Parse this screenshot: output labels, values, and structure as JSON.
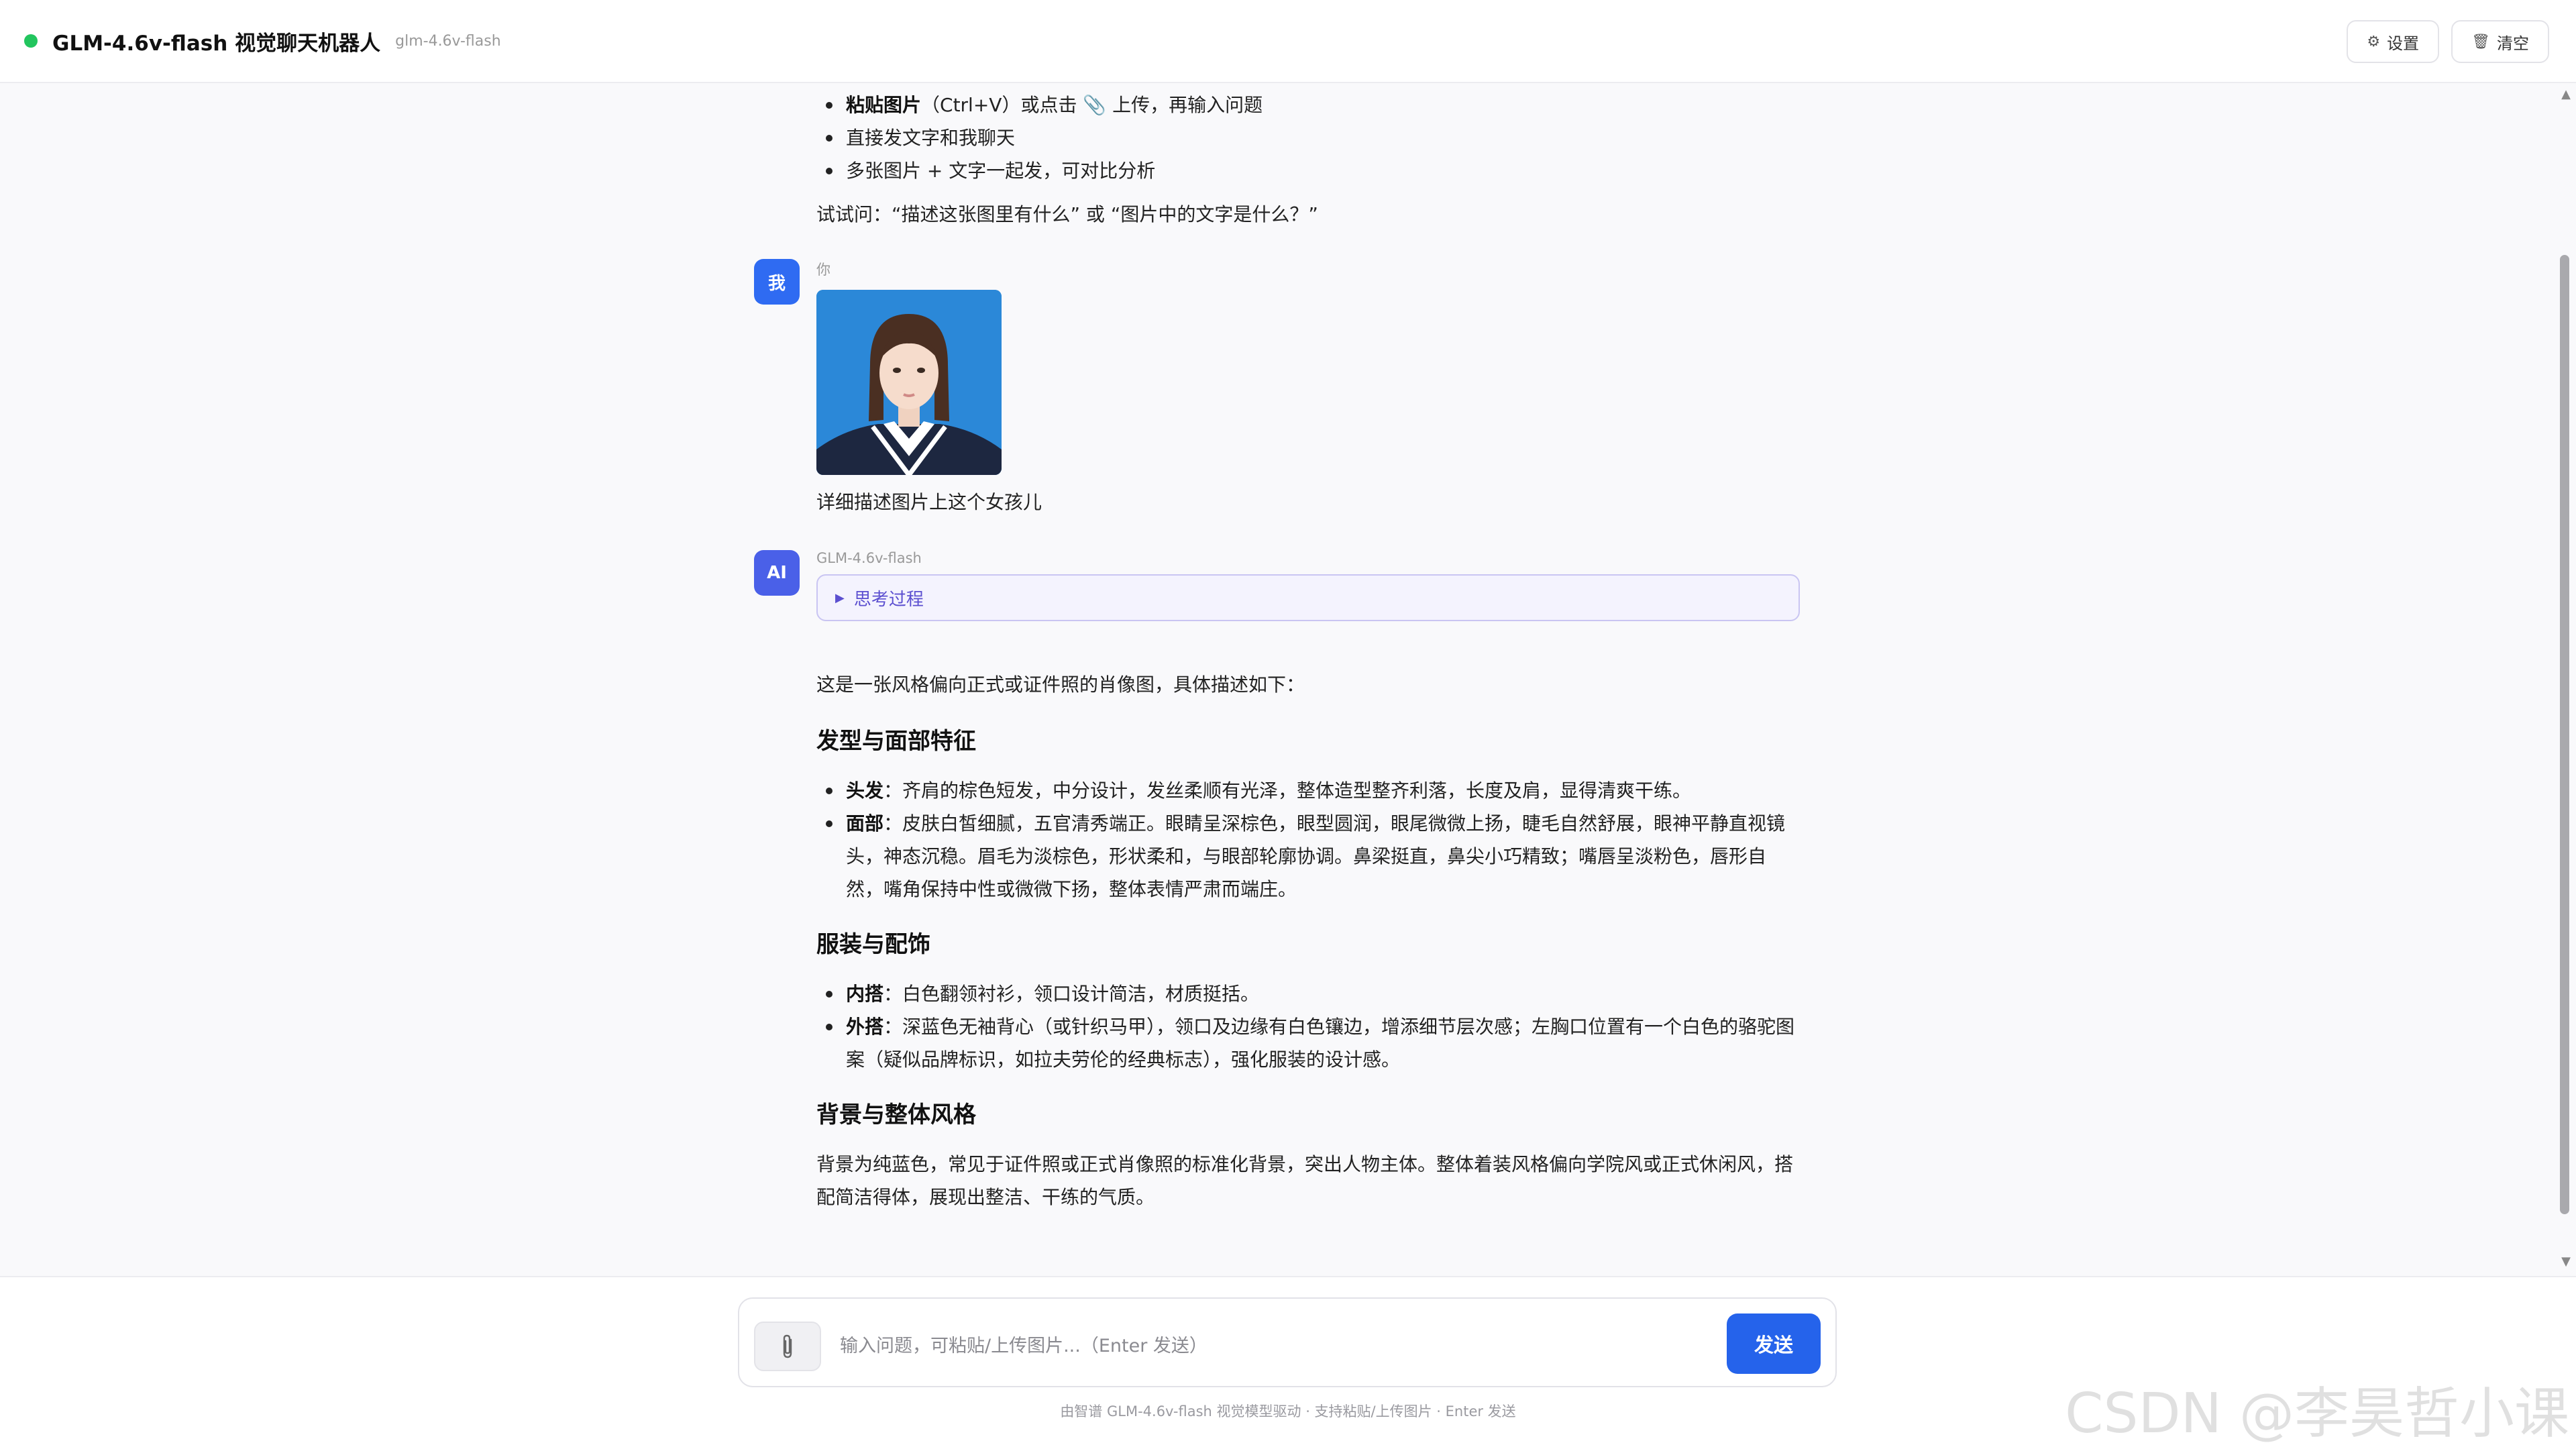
{
  "header": {
    "title": "GLM-4.6v-flash 视觉聊天机器人",
    "model_tag": "glm-4.6v-flash",
    "settings_label": "设置",
    "clear_label": "清空",
    "status_color": "#22c55e"
  },
  "intro": {
    "tips": [
      {
        "bold": "粘贴图片",
        "text": "（Ctrl+V）或点击 📎 上传，再输入问题"
      },
      {
        "bold": "",
        "text": "直接发文字和我聊天"
      },
      {
        "bold": "",
        "text": "多张图片 + 文字一起发，可对比分析"
      }
    ],
    "try_text": "试试问：“描述这张图里有什么” 或 “图片中的文字是什么？”"
  },
  "user_msg": {
    "avatar": "我",
    "sender": "你",
    "image_icon": "portrait-photo",
    "text": "详细描述图片上这个女孩儿"
  },
  "ai_msg": {
    "avatar": "AI",
    "sender": "GLM-4.6v-flash",
    "thinking_label": "思考过程",
    "intro": "这是一张风格偏向正式或证件照的肖像图，具体描述如下：",
    "sections": [
      {
        "heading": "发型与面部特征",
        "items": [
          {
            "bold": "头发",
            "text": "：齐肩的棕色短发，中分设计，发丝柔顺有光泽，整体造型整齐利落，长度及肩，显得清爽干练。"
          },
          {
            "bold": "面部",
            "text": "：皮肤白皙细腻，五官清秀端正。眼睛呈深棕色，眼型圆润，眼尾微微上扬，睫毛自然舒展，眼神平静直视镜头，神态沉稳。眉毛为淡棕色，形状柔和，与眼部轮廓协调。鼻梁挺直，鼻尖小巧精致；嘴唇呈淡粉色，唇形自然，嘴角保持中性或微微下扬，整体表情严肃而端庄。"
          }
        ]
      },
      {
        "heading": "服装与配饰",
        "items": [
          {
            "bold": "内搭",
            "text": "：白色翻领衬衫，领口设计简洁，材质挺括。"
          },
          {
            "bold": "外搭",
            "text": "：深蓝色无袖背心（或针织马甲），领口及边缘有白色镶边，增添细节层次感；左胸口位置有一个白色的骆驼图案（疑似品牌标识，如拉夫劳伦的经典标志），强化服装的设计感。"
          }
        ]
      },
      {
        "heading": "背景与整体风格",
        "paragraph": "背景为纯蓝色，常见于证件照或正式肖像照的标准化背景，突出人物主体。整体着装风格偏向学院风或正式休闲风，搭配简洁得体，展现出整洁、干练的气质。"
      }
    ]
  },
  "composer": {
    "attach_icon": "paperclip-icon",
    "placeholder": "输入问题，可粘贴/上传图片...（Enter 发送）",
    "value": "",
    "send_label": "发送",
    "send_color": "#2563eb"
  },
  "footer_note": "由智谱 GLM-4.6v-flash 视觉模型驱动 · 支持粘贴/上传图片 · Enter 发送",
  "watermark": "CSDN @李昊哲小课"
}
